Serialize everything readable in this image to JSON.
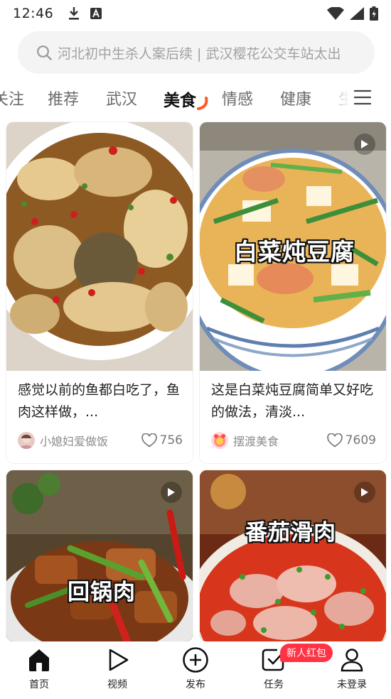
{
  "status_bar": {
    "time": "12:46"
  },
  "search": {
    "placeholder": "河北初中生杀人案后续 | 武汉樱花公交车站太出"
  },
  "tabs": [
    {
      "label": "关注"
    },
    {
      "label": "推荐"
    },
    {
      "label": "武汉"
    },
    {
      "label": "美食",
      "active": true
    },
    {
      "label": "情感"
    },
    {
      "label": "健康"
    },
    {
      "label": "生"
    }
  ],
  "feed": [
    {
      "title": "感觉以前的鱼都白吃了，鱼肉这样做，...",
      "author": "小媳妇爱做饭",
      "likes": "756",
      "has_play": false,
      "overlay": ""
    },
    {
      "title": "这是白菜炖豆腐简单又好吃的做法，清淡...",
      "author": "摆渡美食",
      "likes": "7609",
      "has_play": true,
      "overlay": "白菜炖豆腐"
    },
    {
      "title": "",
      "author": "",
      "likes": "",
      "has_play": true,
      "overlay": "回锅肉"
    },
    {
      "title": "",
      "author": "",
      "likes": "",
      "has_play": true,
      "overlay": "番茄滑肉"
    }
  ],
  "bottom_nav": [
    {
      "label": "首页",
      "icon": "home-icon",
      "active": true
    },
    {
      "label": "视频",
      "icon": "video-play-icon"
    },
    {
      "label": "发布",
      "icon": "plus-circle-icon"
    },
    {
      "label": "任务",
      "icon": "task-check-icon",
      "badge": "新人红包"
    },
    {
      "label": "未登录",
      "icon": "user-icon"
    }
  ],
  "colors": {
    "accent": "#ff3344",
    "tab_underline": "#ff5a1f",
    "search_bg": "#f4f4f4"
  }
}
